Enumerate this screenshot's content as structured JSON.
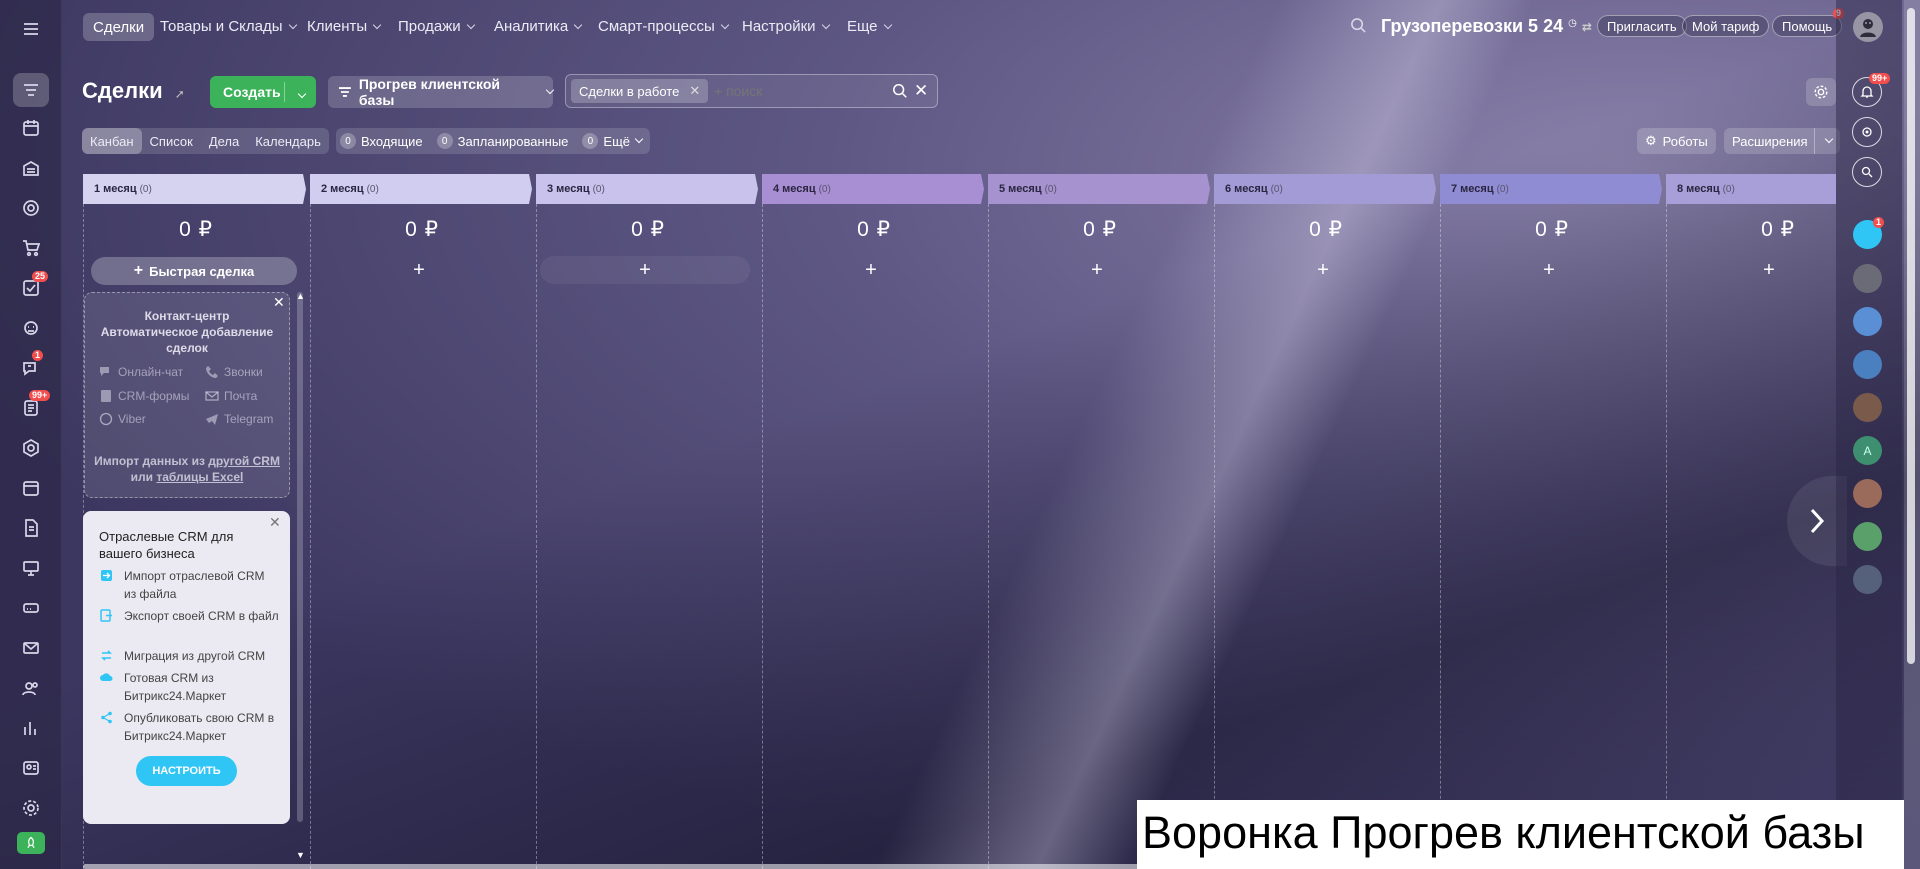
{
  "header": {
    "menu": [
      {
        "label": "Сделки",
        "active": true
      },
      {
        "label": "Товары и Склады"
      },
      {
        "label": "Клиенты"
      },
      {
        "label": "Продажи"
      },
      {
        "label": "Аналитика"
      },
      {
        "label": "Смарт-процессы"
      },
      {
        "label": "Настройки"
      },
      {
        "label": "Еще"
      }
    ],
    "company_name": "Грузоперевозки 5",
    "clock": "24",
    "invite_label": "Пригласить",
    "tariff_label": "Мой тариф",
    "help_label": "Помощь",
    "help_badge": "9"
  },
  "left_sidebar": {
    "badges": {
      "tasks": "25",
      "chat": "1",
      "feed": "99+"
    }
  },
  "toolbar": {
    "title": "Сделки",
    "create_label": "Создать",
    "funnel_label": "Прогрев клиентской базы",
    "filter_chip": "Сделки в работе",
    "search_placeholder": "+ поиск"
  },
  "views": {
    "tabs": [
      "Канбан",
      "Список",
      "Дела",
      "Календарь"
    ],
    "counters": [
      {
        "count": "0",
        "label": "Входящие"
      },
      {
        "count": "0",
        "label": "Запланированные"
      },
      {
        "count": "0",
        "label": "Ещё"
      }
    ],
    "robots_label": "Роботы",
    "extensions_label": "Расширения"
  },
  "kanban": {
    "stages": [
      {
        "name": "1 месяц",
        "count": "(0)",
        "sum": "0 ₽",
        "color": "#d6d3f0"
      },
      {
        "name": "2 месяц",
        "count": "(0)",
        "sum": "0 ₽",
        "color": "#d1cdf0"
      },
      {
        "name": "3 месяц",
        "count": "(0)",
        "sum": "0 ₽",
        "color": "#c8c2ec"
      },
      {
        "name": "4 месяц",
        "count": "(0)",
        "sum": "0 ₽",
        "color": "#a88ed2"
      },
      {
        "name": "5 месяц",
        "count": "(0)",
        "sum": "0 ₽",
        "color": "#a592cf"
      },
      {
        "name": "6 месяц",
        "count": "(0)",
        "sum": "0 ₽",
        "color": "#a39bd6"
      },
      {
        "name": "7 месяц",
        "count": "(0)",
        "sum": "0 ₽",
        "color": "#908cd4"
      },
      {
        "name": "8 месяц",
        "count": "(0)",
        "sum": "0 ₽",
        "color": "#a89fd8"
      }
    ],
    "quick_deal_label": "Быстрая сделка"
  },
  "contact_center": {
    "title_lines": [
      "Контакт-центр",
      "Автоматическое добавление",
      "сделок"
    ],
    "channels": [
      "Онлайн-чат",
      "Звонки",
      "CRM-формы",
      "Почта",
      "Viber",
      "Telegram"
    ],
    "import_prefix": "Импорт данных из",
    "import_link1": "другой CRM",
    "import_or": "или",
    "import_link2": "таблицы Excel"
  },
  "industry_crm": {
    "title": "Отраслевые CRM для вашего бизнеса",
    "items": [
      "Импорт отраслевой CRM из файла",
      "Экспорт своей CRM в файл",
      "Миграция из другой CRM",
      "Готовая CRM из Битрикс24.Маркет",
      "Опубликовать свою CRM в Битрикс24.Маркет"
    ],
    "button_label": "НАСТРОИТЬ"
  },
  "right_rail": {
    "notifications_badge": "99+",
    "chat_badge": "1",
    "avatar_letter": "A"
  },
  "caption": "Воронка Прогрев клиентской базы",
  "colors": {
    "accent_green": "#3cb35a",
    "setup_blue": "#2fc6f6",
    "badge_red": "#f24e4e"
  }
}
